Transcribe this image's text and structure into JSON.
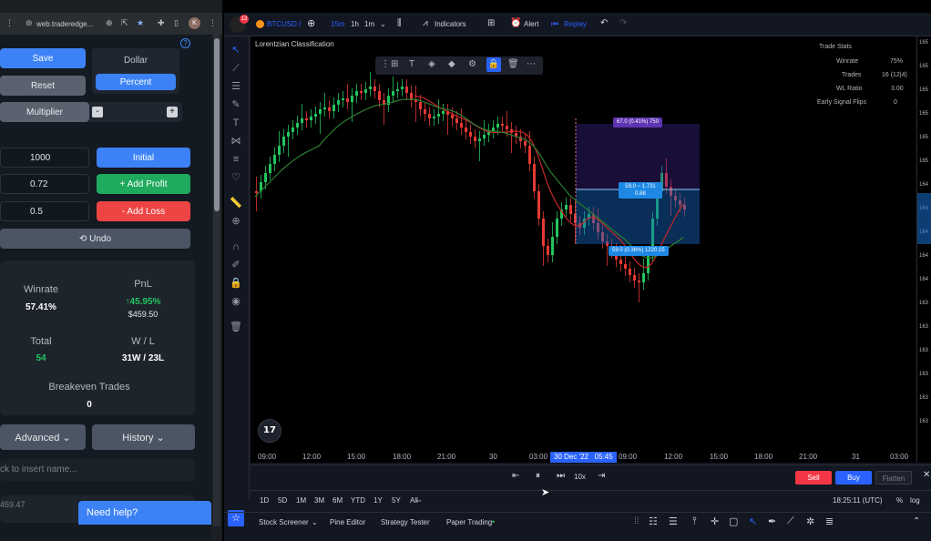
{
  "browser": {
    "url": "web.traderedge...",
    "badge_count": "13",
    "profile_initial": "K"
  },
  "left_panel": {
    "save_label": "Save",
    "reset_label": "Reset",
    "dollar_label": "Dollar",
    "percent_label": "Percent",
    "multiplier_label": "Multiplier",
    "minus_label": "-",
    "plus_label": "+",
    "initial_value": "1000",
    "initial_label": "Initial",
    "profit_value": "0.72",
    "add_profit_label": "+ Add Profit",
    "loss_value": "0.5",
    "add_loss_label": "- Add Loss",
    "undo_label": "⟲ Undo",
    "winrate_label": "Winrate",
    "winrate_value": "57.41%",
    "pnl_label": "PnL",
    "pnl_pct": "↑45.95%",
    "pnl_value": "$459.50",
    "total_label": "Total",
    "total_value": "54",
    "wl_label": "W / L",
    "wl_value": "31W / 23L",
    "breakeven_label": "Breakeven Trades",
    "breakeven_value": "0",
    "advanced_label": "Advanced ⌄",
    "history_label": "History ⌄",
    "name_placeholder": "ck to insert name...",
    "bottom_value": "459.47",
    "help_label": "Need help?",
    "help_icon": "question-icon"
  },
  "toolbar": {
    "symbol": "BTCUSD.I",
    "intervals": [
      "15m",
      "1h",
      "1m"
    ],
    "indicators_label": "Indicators",
    "alert_label": "Alert",
    "replay_label": "Replay"
  },
  "chart": {
    "indicator_title": "Lorentzian Classification",
    "trade_stats": {
      "title": "Trade Stats",
      "rows": [
        {
          "label": "Winrate",
          "value": "75%"
        },
        {
          "label": "Trades",
          "value": "16 (12|4)"
        },
        {
          "label": "WL Ratio",
          "value": "3.00"
        },
        {
          "label": "Early Signal Flips",
          "value": "0"
        }
      ]
    },
    "position_labels": {
      "target": "67.0 (0.41%) 750",
      "mid_line1": "59.0 − 1.731",
      "mid_line2": "0.88",
      "stop": "59.0 (0.36%) 1220.15"
    },
    "price_ticks": [
      "165",
      "165",
      "165",
      "165",
      "165",
      "165",
      "164",
      "164",
      "164",
      "164",
      "164",
      "163",
      "163",
      "163",
      "163",
      "163",
      "163"
    ],
    "time_ticks": [
      "09:00",
      "12:00",
      "15:00",
      "18:00",
      "21:00",
      "30",
      "03:00",
      "09:00",
      "12:00",
      "15:00",
      "18:00",
      "21:00",
      "31",
      "03:00"
    ],
    "current_date": "30 Dec '22",
    "current_time": "05:45",
    "colors": {
      "up": "#26a69a",
      "down": "#ef5350",
      "up_bright": "#22c55e",
      "down_bright": "#e53935",
      "ma_red": "#c62828",
      "ma_green": "#2e7d32"
    }
  },
  "replay": {
    "speed": "10x",
    "sell_label": "Sell",
    "buy_label": "Buy",
    "flatten_label": "Flatten"
  },
  "range_bar": {
    "ranges": [
      "1D",
      "5D",
      "1M",
      "3M",
      "6M",
      "YTD",
      "1Y",
      "5Y",
      "All"
    ],
    "clock": "18:25:11 (UTC)",
    "percent_label": "%",
    "log_label": "log"
  },
  "bottom_tabs": [
    "Stock Screener",
    "Pine Editor",
    "Strategy Tester",
    "Paper Trading"
  ]
}
